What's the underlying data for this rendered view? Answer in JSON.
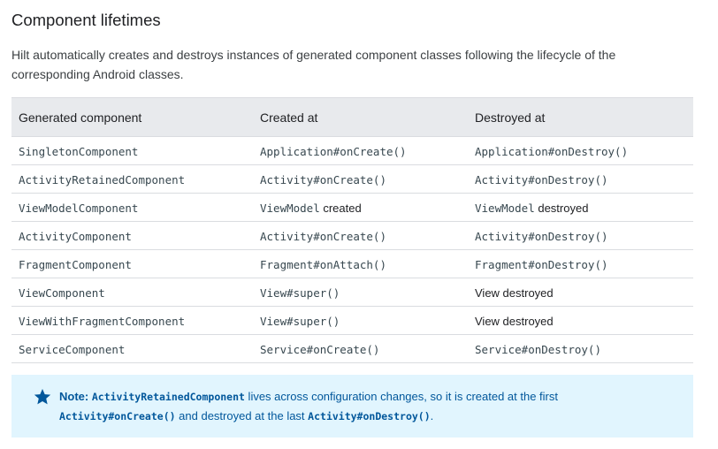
{
  "title": "Component lifetimes",
  "intro": "Hilt automatically creates and destroys instances of generated component classes following the lifecycle of the corresponding Android classes.",
  "table": {
    "headers": [
      "Generated component",
      "Created at",
      "Destroyed at"
    ],
    "rows": [
      {
        "component": "SingletonComponent",
        "created_code": "Application#onCreate()",
        "created_text": "",
        "destroyed_code": "Application#onDestroy()",
        "destroyed_text": ""
      },
      {
        "component": "ActivityRetainedComponent",
        "created_code": "Activity#onCreate()",
        "created_text": "",
        "destroyed_code": "Activity#onDestroy()",
        "destroyed_text": ""
      },
      {
        "component": "ViewModelComponent",
        "created_code": "ViewModel",
        "created_text": " created",
        "destroyed_code": "ViewModel",
        "destroyed_text": " destroyed"
      },
      {
        "component": "ActivityComponent",
        "created_code": "Activity#onCreate()",
        "created_text": "",
        "destroyed_code": "Activity#onDestroy()",
        "destroyed_text": ""
      },
      {
        "component": "FragmentComponent",
        "created_code": "Fragment#onAttach()",
        "created_text": "",
        "destroyed_code": "Fragment#onDestroy()",
        "destroyed_text": ""
      },
      {
        "component": "ViewComponent",
        "created_code": "View#super()",
        "created_text": "",
        "destroyed_code": "",
        "destroyed_text": "View destroyed"
      },
      {
        "component": "ViewWithFragmentComponent",
        "created_code": "View#super()",
        "created_text": "",
        "destroyed_code": "",
        "destroyed_text": "View destroyed"
      },
      {
        "component": "ServiceComponent",
        "created_code": "Service#onCreate()",
        "created_text": "",
        "destroyed_code": "Service#onDestroy()",
        "destroyed_text": ""
      }
    ]
  },
  "note": {
    "icon": "star-icon",
    "label": "Note:",
    "code1": "ActivityRetainedComponent",
    "text1": " lives across configuration changes, so it is created at the first ",
    "code2": "Activity#onCreate()",
    "text2": " and destroyed at the last ",
    "code3": "Activity#onDestroy()",
    "text3": "."
  },
  "colors": {
    "header_bg": "#e8eaed",
    "note_bg": "#e1f5fe",
    "note_text": "#01579b"
  }
}
